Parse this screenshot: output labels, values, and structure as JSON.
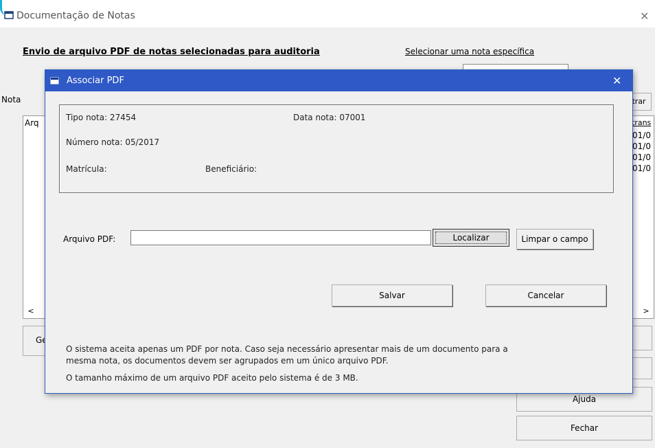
{
  "main_window": {
    "title": "Documentação de Notas",
    "close_glyph": "✕",
    "heading": "Envio de arquivo PDF de notas selecionadas para auditoria",
    "select_link": "Selecionar uma nota específica",
    "notas_label": "Nota",
    "filtrar_label": "ltrar",
    "list": {
      "left_column_header": "Arq",
      "right_column_header": "trans",
      "right_column_values": [
        "01/0",
        "01/0",
        "01/0",
        "01/0"
      ]
    },
    "ge_button": "Ge",
    "ajuda_button": "Ajuda",
    "fechar_button": "Fechar"
  },
  "dialog": {
    "title": "Associar PDF",
    "close_glyph": "✕",
    "tipo_nota": "Tipo nota: 27454",
    "data_nota": "Data nota: 07001",
    "numero_nota": "Número nota: 05/2017",
    "matricula": "Matrícula:",
    "beneficiario": "Beneficiário:",
    "arquivo_label": "Arquivo PDF:",
    "arquivo_value": "",
    "localizar_button": "Localizar",
    "limpar_button": "Limpar o campo",
    "salvar_button": "Salvar",
    "cancelar_button": "Cancelar",
    "info_line1": "O sistema aceita apenas um PDF por nota. Caso seja necessário apresentar mais de um documento para a",
    "info_line2": "mesma nota, os documentos devem ser agrupados em um único arquivo PDF.",
    "info_line3": "O tamanho máximo de um arquivo PDF aceito pelo sistema é de 3 MB."
  },
  "colors": {
    "dialog_titlebar": "#2e59c6",
    "window_bg": "#f0f0f0"
  }
}
